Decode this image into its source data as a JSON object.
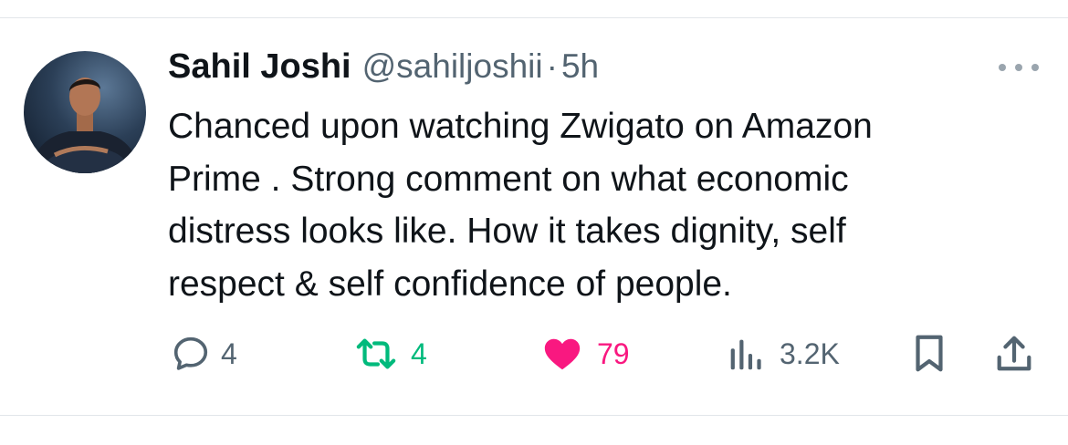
{
  "tweet": {
    "author_name": "Sahil Joshi",
    "handle": "@sahiljoshii",
    "separator": "·",
    "time": "5h",
    "text_lines": [
      "Chanced upon watching Zwigato on Amazon",
      "Prime . Strong comment on what economic",
      "distress looks like. How it takes dignity, self",
      "respect & self confidence of people."
    ]
  },
  "actions": {
    "reply_count": "4",
    "retweet_count": "4",
    "like_count": "79",
    "views_count": "3.2K"
  },
  "icons": {
    "reply": "speech-bubble-icon",
    "retweet": "retweet-arrows-icon",
    "like": "heart-icon",
    "views": "bar-chart-icon",
    "bookmark": "bookmark-icon",
    "share": "share-upload-icon",
    "more": "ellipsis-icon"
  },
  "colors": {
    "text_primary": "#0f1419",
    "text_secondary": "#536471",
    "retweet_green": "#00ba7c",
    "like_pink": "#f91880"
  }
}
